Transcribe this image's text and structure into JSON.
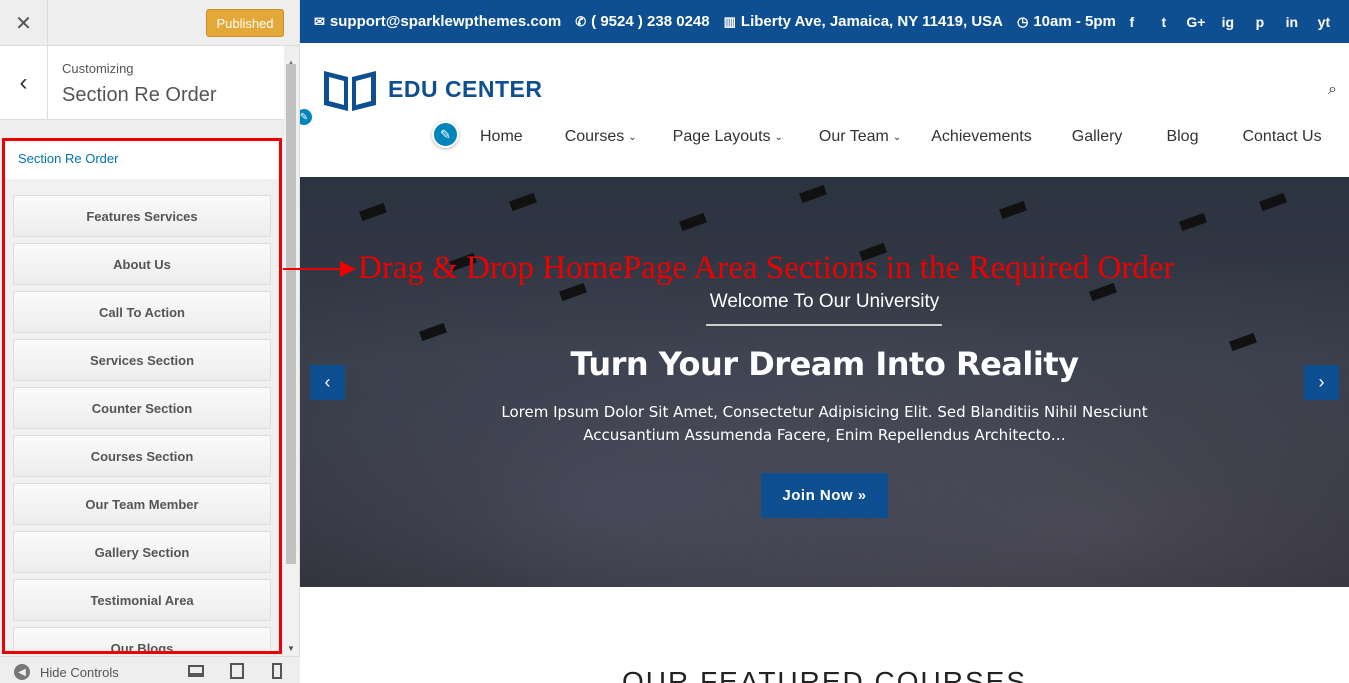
{
  "customizer": {
    "close_label": "✕",
    "publish_label": "Published",
    "breadcrumb_small": "Customizing",
    "breadcrumb_title": "Section Re Order",
    "section_title": "Section Re Order",
    "sections": [
      {
        "label": "Features Services"
      },
      {
        "label": "About Us"
      },
      {
        "label": "Call To Action"
      },
      {
        "label": "Services Section"
      },
      {
        "label": "Counter Section"
      },
      {
        "label": "Courses Section"
      },
      {
        "label": "Our Team Member"
      },
      {
        "label": "Gallery Section"
      },
      {
        "label": "Testimonial Area"
      },
      {
        "label": "Our Blogs"
      }
    ],
    "hide_controls_label": "Hide Controls"
  },
  "topbar": {
    "email": "support@sparklewpthemes.com",
    "phone": "( 9524 ) 238 0248",
    "address": "Liberty Ave, Jamaica, NY 11419, USA",
    "hours": "10am - 5pm",
    "social": [
      "f",
      "t",
      "G+",
      "ig",
      "p",
      "in",
      "yt"
    ]
  },
  "logo_text": "EDU CENTER",
  "nav": [
    {
      "label": "Home",
      "has_caret": false
    },
    {
      "label": "Courses",
      "has_caret": true
    },
    {
      "label": "Page Layouts",
      "has_caret": true
    },
    {
      "label": "Our Team",
      "has_caret": true
    },
    {
      "label": "Achievements",
      "has_caret": false
    },
    {
      "label": "Gallery",
      "has_caret": false
    },
    {
      "label": "Blog",
      "has_caret": false
    },
    {
      "label": "Contact Us",
      "has_caret": false
    }
  ],
  "hero": {
    "subtitle": "Welcome To Our University",
    "title": "Turn Your Dream Into Reality",
    "description": "Lorem Ipsum Dolor Sit Amet, Consectetur Adipisicing Elit. Sed Blanditiis Nihil Nesciunt Accusantium Assumenda Facere, Enim Repellendus Architecto…",
    "button_label": "Join Now »"
  },
  "annotation": "Drag & Drop HomePage Area Sections in the Required Order",
  "featured_heading": "OUR FEATURED COURSES",
  "colors": {
    "brand_blue": "#0d4f91",
    "publish_orange": "#e4a838",
    "annotation_red": "#e00000"
  }
}
